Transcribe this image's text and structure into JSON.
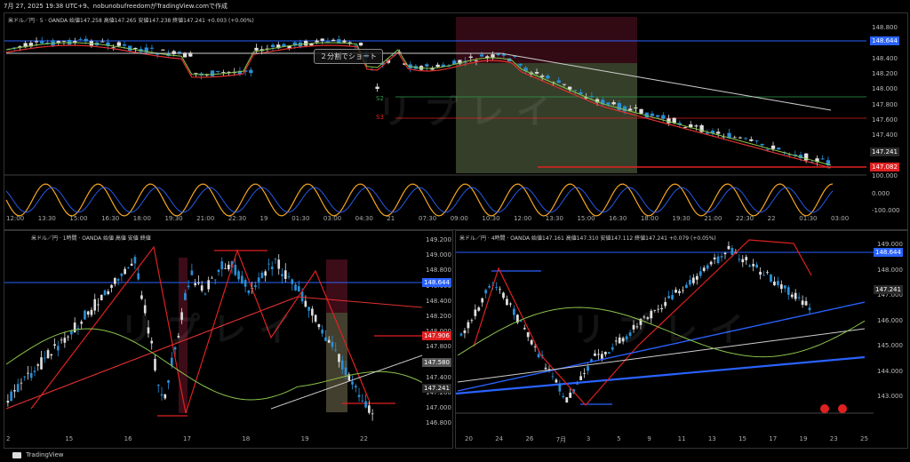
{
  "topbar": {
    "text": "7月 27, 2025 19:38 UTC+9、nobunobufreedomがTradingView.comで作成"
  },
  "footer": {
    "brand": "TradingView"
  },
  "panes": {
    "main": {
      "header": "米ドル／円 · 5 · OANDA  始値147.258  高値147.265  安値147.238  終値147.241  +0.003 (+0.00%)",
      "note": "２分割でショート",
      "watermark": "リプレイ",
      "price_ticks": [
        "148.800",
        "148.600",
        "148.400",
        "148.200",
        "148.000",
        "147.800",
        "147.600",
        "147.400",
        "147.200",
        "147.000"
      ],
      "tags": [
        {
          "text": "148.644",
          "color": "#2962ff"
        },
        {
          "text": "147.241",
          "color": "#2a2a2a"
        },
        {
          "text": "147.082",
          "color": "#e02020"
        }
      ],
      "osc_ticks": [
        "100.000",
        "0.000",
        "-100.000"
      ],
      "x_labels": [
        "12:00",
        "13:30",
        "15:00",
        "16:30",
        "18:00",
        "19:30",
        "21:00",
        "22:30",
        "19",
        "01:30",
        "03:00",
        "04:30",
        "21",
        "07:30",
        "09:00",
        "10:30",
        "12:00",
        "13:30",
        "15:00",
        "16:30",
        "18:00",
        "19:30",
        "21:00",
        "22:30",
        "22",
        "01:30",
        "03:00"
      ],
      "levels": [
        "S2",
        "S3"
      ]
    },
    "h1": {
      "header": "米ドル／円 · 1時間 · OANDA  始値  高値  安値  終値",
      "watermark": "リプレイ",
      "price_ticks": [
        "149.200",
        "149.000",
        "148.800",
        "148.600",
        "148.400",
        "148.200",
        "148.000",
        "147.800",
        "147.600",
        "147.400",
        "147.200",
        "147.000",
        "146.800"
      ],
      "tags": [
        {
          "text": "148.644",
          "color": "#2962ff"
        },
        {
          "text": "147.906",
          "color": "#e02020"
        },
        {
          "text": "147.580",
          "color": "#555"
        },
        {
          "text": "147.241",
          "color": "#2a2a2a"
        }
      ],
      "x_labels": [
        "2",
        "15",
        "16",
        "17",
        "18",
        "19",
        "22"
      ],
      "levels": [
        "R3",
        "R1",
        "R2",
        "S1",
        "P",
        "S2",
        "S1"
      ]
    },
    "h4": {
      "header": "米ドル／円 · 4時間 · OANDA  始値147.161  高値147.310  安値147.112  終値147.241  +0.079 (+0.05%)",
      "watermark": "リプレイ",
      "price_ticks": [
        "149.000",
        "148.000",
        "147.000",
        "146.000",
        "145.000",
        "144.000",
        "143.000"
      ],
      "tags": [
        {
          "text": "148.644",
          "color": "#2962ff"
        },
        {
          "text": "147.241",
          "color": "#2a2a2a"
        }
      ],
      "x_labels": [
        "20",
        "24",
        "26",
        "7月",
        "3",
        "5",
        "9",
        "11",
        "13",
        "15",
        "17",
        "19",
        "23",
        "25"
      ],
      "levels": [
        "R2",
        "R1",
        "P",
        "S1",
        "S2",
        "R3",
        "R1",
        "S1",
        "S2",
        "S3"
      ]
    }
  }
}
